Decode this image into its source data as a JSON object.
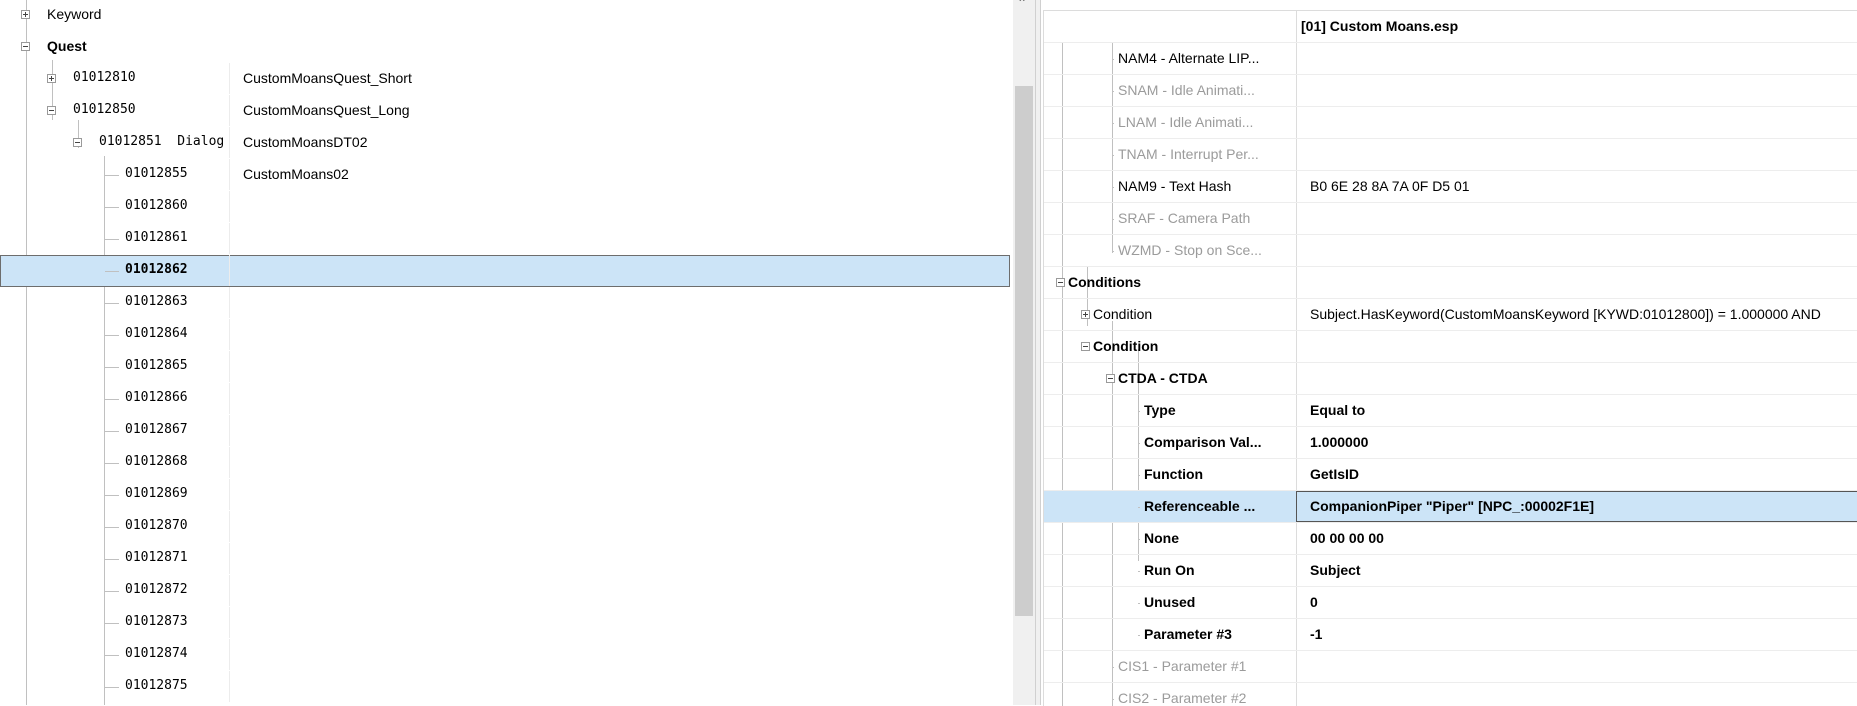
{
  "left_tree": {
    "rows": [
      {
        "id": "keyword",
        "label": "Keyword",
        "bold": false,
        "mono": false,
        "col2": "",
        "expander": "plus"
      },
      {
        "id": "quest",
        "label": "Quest",
        "bold": true,
        "mono": false,
        "col2": "",
        "expander": "minus"
      },
      {
        "id": "r01012810",
        "label": "01012810",
        "bold": false,
        "mono": true,
        "col2": "CustomMoansQuest_Short",
        "expander": "plus"
      },
      {
        "id": "r01012850",
        "label": "01012850",
        "bold": false,
        "mono": true,
        "col2": "CustomMoansQuest_Long",
        "expander": "minus"
      },
      {
        "id": "r01012851",
        "label": "01012851  Dialog",
        "bold": false,
        "mono": true,
        "col2": "CustomMoansDT02",
        "expander": "minus"
      },
      {
        "id": "r01012855",
        "label": "01012855",
        "bold": false,
        "mono": true,
        "col2": "CustomMoans02",
        "expander": ""
      },
      {
        "id": "r01012860",
        "label": "01012860",
        "bold": false,
        "mono": true,
        "col2": "",
        "expander": ""
      },
      {
        "id": "r01012861",
        "label": "01012861",
        "bold": false,
        "mono": true,
        "col2": "",
        "expander": ""
      },
      {
        "id": "r01012862",
        "label": "01012862",
        "bold": true,
        "mono": true,
        "col2": "",
        "expander": "",
        "selected": true
      },
      {
        "id": "r01012863",
        "label": "01012863",
        "bold": false,
        "mono": true,
        "col2": "",
        "expander": ""
      },
      {
        "id": "r01012864",
        "label": "01012864",
        "bold": false,
        "mono": true,
        "col2": "",
        "expander": ""
      },
      {
        "id": "r01012865",
        "label": "01012865",
        "bold": false,
        "mono": true,
        "col2": "",
        "expander": ""
      },
      {
        "id": "r01012866",
        "label": "01012866",
        "bold": false,
        "mono": true,
        "col2": "",
        "expander": ""
      },
      {
        "id": "r01012867",
        "label": "01012867",
        "bold": false,
        "mono": true,
        "col2": "",
        "expander": ""
      },
      {
        "id": "r01012868",
        "label": "01012868",
        "bold": false,
        "mono": true,
        "col2": "",
        "expander": ""
      },
      {
        "id": "r01012869",
        "label": "01012869",
        "bold": false,
        "mono": true,
        "col2": "",
        "expander": ""
      },
      {
        "id": "r01012870",
        "label": "01012870",
        "bold": false,
        "mono": true,
        "col2": "",
        "expander": ""
      },
      {
        "id": "r01012871",
        "label": "01012871",
        "bold": false,
        "mono": true,
        "col2": "",
        "expander": ""
      },
      {
        "id": "r01012872",
        "label": "01012872",
        "bold": false,
        "mono": true,
        "col2": "",
        "expander": ""
      },
      {
        "id": "r01012873",
        "label": "01012873",
        "bold": false,
        "mono": true,
        "col2": "",
        "expander": ""
      },
      {
        "id": "r01012874",
        "label": "01012874",
        "bold": false,
        "mono": true,
        "col2": "",
        "expander": ""
      },
      {
        "id": "r01012875",
        "label": "01012875",
        "bold": false,
        "mono": true,
        "col2": "",
        "expander": ""
      }
    ]
  },
  "right_view": {
    "header_value": "[01] Custom Moans.esp",
    "rows": [
      {
        "id": "nam4",
        "name": "NAM4 - Alternate LIP...",
        "value": "",
        "style": "normal",
        "level": 3,
        "expander": ""
      },
      {
        "id": "snam",
        "name": "SNAM - Idle Animati...",
        "value": "",
        "style": "gray",
        "level": 3,
        "expander": ""
      },
      {
        "id": "lnam",
        "name": "LNAM - Idle Animati...",
        "value": "",
        "style": "gray",
        "level": 3,
        "expander": ""
      },
      {
        "id": "tnam",
        "name": "TNAM - Interrupt Per...",
        "value": "",
        "style": "gray",
        "level": 3,
        "expander": ""
      },
      {
        "id": "nam9",
        "name": "NAM9 - Text Hash",
        "value": "B0 6E 28 8A 7A 0F D5 01",
        "style": "normal",
        "level": 3,
        "expander": ""
      },
      {
        "id": "sraf",
        "name": "SRAF - Camera Path",
        "value": "",
        "style": "gray",
        "level": 3,
        "expander": ""
      },
      {
        "id": "wzmd",
        "name": "WZMD - Stop on Sce...",
        "value": "",
        "style": "gray",
        "level": 3,
        "expander": ""
      },
      {
        "id": "conditions",
        "name": "Conditions",
        "value": "",
        "style": "bold",
        "level": 1,
        "expander": "minus"
      },
      {
        "id": "condition1",
        "name": "Condition",
        "value": "Subject.HasKeyword(CustomMoansKeyword [KYWD:01012800]) = 1.000000 AND",
        "style": "normal",
        "level": 2,
        "expander": "plus"
      },
      {
        "id": "condition2",
        "name": "Condition",
        "value": "",
        "style": "bold",
        "level": 2,
        "expander": "minus"
      },
      {
        "id": "ctda",
        "name": "CTDA - CTDA",
        "value": "",
        "style": "bold",
        "level": 3,
        "expander": "minus"
      },
      {
        "id": "type",
        "name": "Type",
        "value": "Equal to",
        "style": "bold",
        "level": 4,
        "expander": ""
      },
      {
        "id": "compval",
        "name": "Comparison Val...",
        "value": "1.000000",
        "style": "bold",
        "level": 4,
        "expander": ""
      },
      {
        "id": "function",
        "name": "Function",
        "value": "GetIsID",
        "style": "bold",
        "level": 4,
        "expander": ""
      },
      {
        "id": "refable",
        "name": "Referenceable ...",
        "value": "CompanionPiper \"Piper\" [NPC_:00002F1E]",
        "style": "bold",
        "level": 4,
        "expander": "",
        "selected": true
      },
      {
        "id": "none",
        "name": "None",
        "value": "00 00 00 00",
        "style": "bold",
        "level": 4,
        "expander": ""
      },
      {
        "id": "runon",
        "name": "Run On",
        "value": "Subject",
        "style": "bold",
        "level": 4,
        "expander": ""
      },
      {
        "id": "unused",
        "name": "Unused",
        "value": "0",
        "style": "bold",
        "level": 4,
        "expander": ""
      },
      {
        "id": "param3",
        "name": "Parameter #3",
        "value": "-1",
        "style": "bold",
        "level": 4,
        "expander": ""
      },
      {
        "id": "cis1",
        "name": "CIS1 - Parameter #1",
        "value": "",
        "style": "gray",
        "level": 3,
        "expander": ""
      },
      {
        "id": "cis2",
        "name": "CIS2 - Parameter #2",
        "value": "",
        "style": "gray",
        "level": 3,
        "expander": ""
      }
    ]
  }
}
